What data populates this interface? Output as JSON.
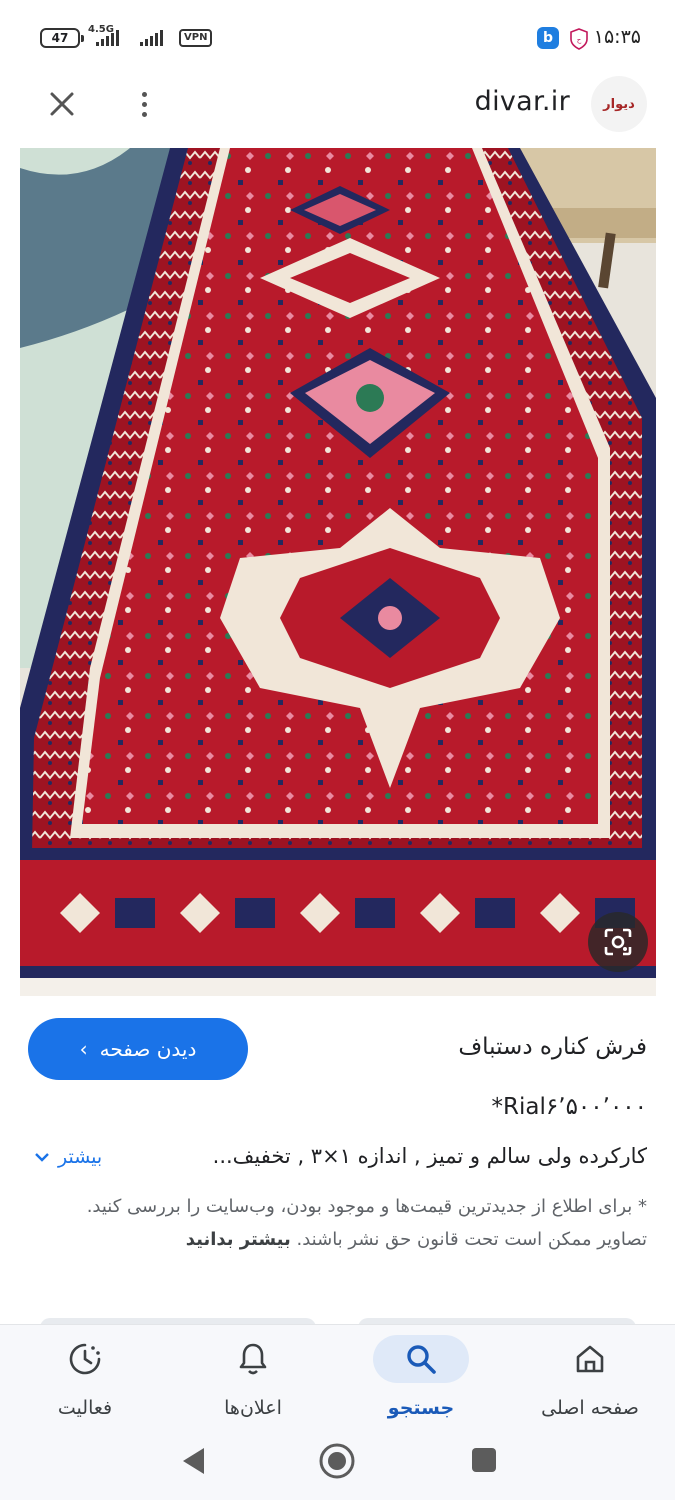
{
  "status_bar": {
    "battery": "47",
    "network": "4.5G",
    "vpn": "VPN",
    "time": "۱۵:۳۵",
    "icons": [
      "battery-icon",
      "signal-icon",
      "vpn-icon",
      "bale-icon",
      "shield-icon"
    ]
  },
  "header": {
    "domain": "divar.ir",
    "logo_text": "دیوار",
    "icons": [
      "close-icon",
      "more-vert-icon"
    ]
  },
  "image": {
    "alt": "فرش کناره دستباف",
    "icons": [
      "google-lens-icon"
    ]
  },
  "result": {
    "visit_button": "دیدن صفحه",
    "title": "فرش کناره دستباف",
    "price": "*Rial۶٬۵۰۰٬۰۰۰",
    "description": "کارکرده ولی سالم و تمیز , اندازه ۱×۳ , تخفیف...",
    "more": "بیشتر",
    "notice": "* برای اطلاع از جدیدترین قیمت‌ها و موجود بودن، وب‌سایت را بررسی کنید. تصاویر ممکن است تحت قانون حق نشر باشند.",
    "learn_more": "بیشتر بدانید"
  },
  "bottom_nav": {
    "items": [
      {
        "label": "فعالیت",
        "icon": "activity-icon",
        "active": false
      },
      {
        "label": "اعلان‌ها",
        "icon": "bell-icon",
        "active": false
      },
      {
        "label": "جستجو",
        "icon": "search-icon",
        "active": true
      },
      {
        "label": "صفحه اصلی",
        "icon": "home-icon",
        "active": false
      }
    ]
  },
  "colors": {
    "accent": "#1a73e8",
    "rug_red": "#b81a2b",
    "rug_navy": "#23285e",
    "rug_cream": "#f1e6d8"
  }
}
